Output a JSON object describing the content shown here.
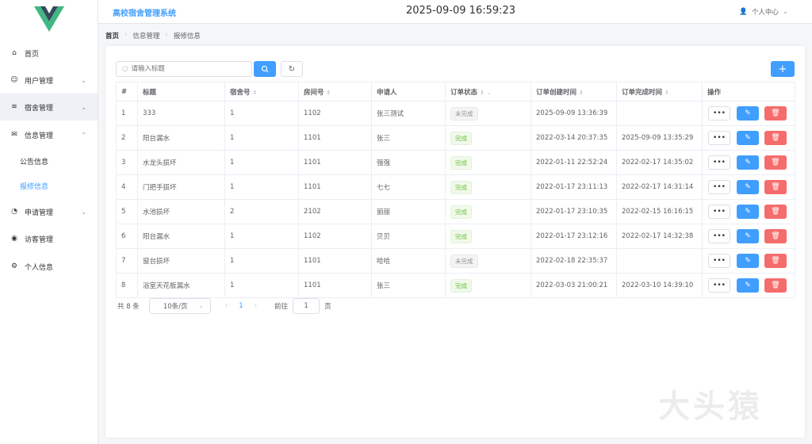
{
  "app": {
    "title": "高校宿舍管理系统",
    "datetime": "2025-09-09 16:59:23",
    "user_menu": "个人中心",
    "watermark": "大头猿"
  },
  "sidebar": {
    "items": [
      {
        "label": "首页",
        "icon": "home-icon"
      },
      {
        "label": "用户管理",
        "icon": "user-icon"
      },
      {
        "label": "宿舍管理",
        "icon": "database-icon"
      },
      {
        "label": "信息管理",
        "icon": "message-icon"
      },
      {
        "label": "公告信息"
      },
      {
        "label": "报修信息"
      },
      {
        "label": "申请管理",
        "icon": "pie-chart-icon"
      },
      {
        "label": "访客管理",
        "icon": "eye-icon"
      },
      {
        "label": "个人信息",
        "icon": "gear-icon"
      }
    ]
  },
  "breadcrumb": [
    "首页",
    "信息管理",
    "报修信息"
  ],
  "toolbar": {
    "search_placeholder": "请输入标题",
    "add_label": "+"
  },
  "table": {
    "headers": [
      "#",
      "标题",
      "宿舍号",
      "房间号",
      "申请人",
      "订单状态",
      "订单创建时间",
      "订单完成时间",
      "操作"
    ],
    "rows": [
      [
        "1",
        "333",
        "1",
        "1102",
        "张三测试",
        "未完成",
        "2025-09-09 13:36:39",
        ""
      ],
      [
        "2",
        "阳台漏水",
        "1",
        "1101",
        "张三",
        "完成",
        "2022-03-14 20:37:35",
        "2025-09-09 13:35:29"
      ],
      [
        "3",
        "水龙头损坏",
        "1",
        "1101",
        "强强",
        "完成",
        "2022-01-11 22:52:24",
        "2022-02-17 14:35:02"
      ],
      [
        "4",
        "门把手损坏",
        "1",
        "1101",
        "七七",
        "完成",
        "2022-01-17 23:11:13",
        "2022-02-17 14:31:14"
      ],
      [
        "5",
        "水池损坏",
        "2",
        "2102",
        "丽丽",
        "完成",
        "2022-01-17 23:10:35",
        "2022-02-15 16:16:15"
      ],
      [
        "6",
        "阳台漏水",
        "1",
        "1102",
        "贝贝",
        "完成",
        "2022-01-17 23:12:16",
        "2022-02-17 14:32:38"
      ],
      [
        "7",
        "窗台损坏",
        "1",
        "1101",
        "哈哈",
        "未完成",
        "2022-02-18 22:35:37",
        ""
      ],
      [
        "8",
        "浴室天花板漏水",
        "1",
        "1101",
        "张三",
        "完成",
        "2022-03-03 21:00:21",
        "2022-03-10 14:39:10"
      ]
    ]
  },
  "pagination": {
    "total": "共 8 条",
    "page_size": "10条/页",
    "current": "1",
    "goto_label": "前往",
    "goto_value": "1",
    "page_suffix": "页"
  },
  "colors": {
    "primary": "#409eff",
    "danger": "#f56c6c",
    "success": "#67c23a"
  }
}
